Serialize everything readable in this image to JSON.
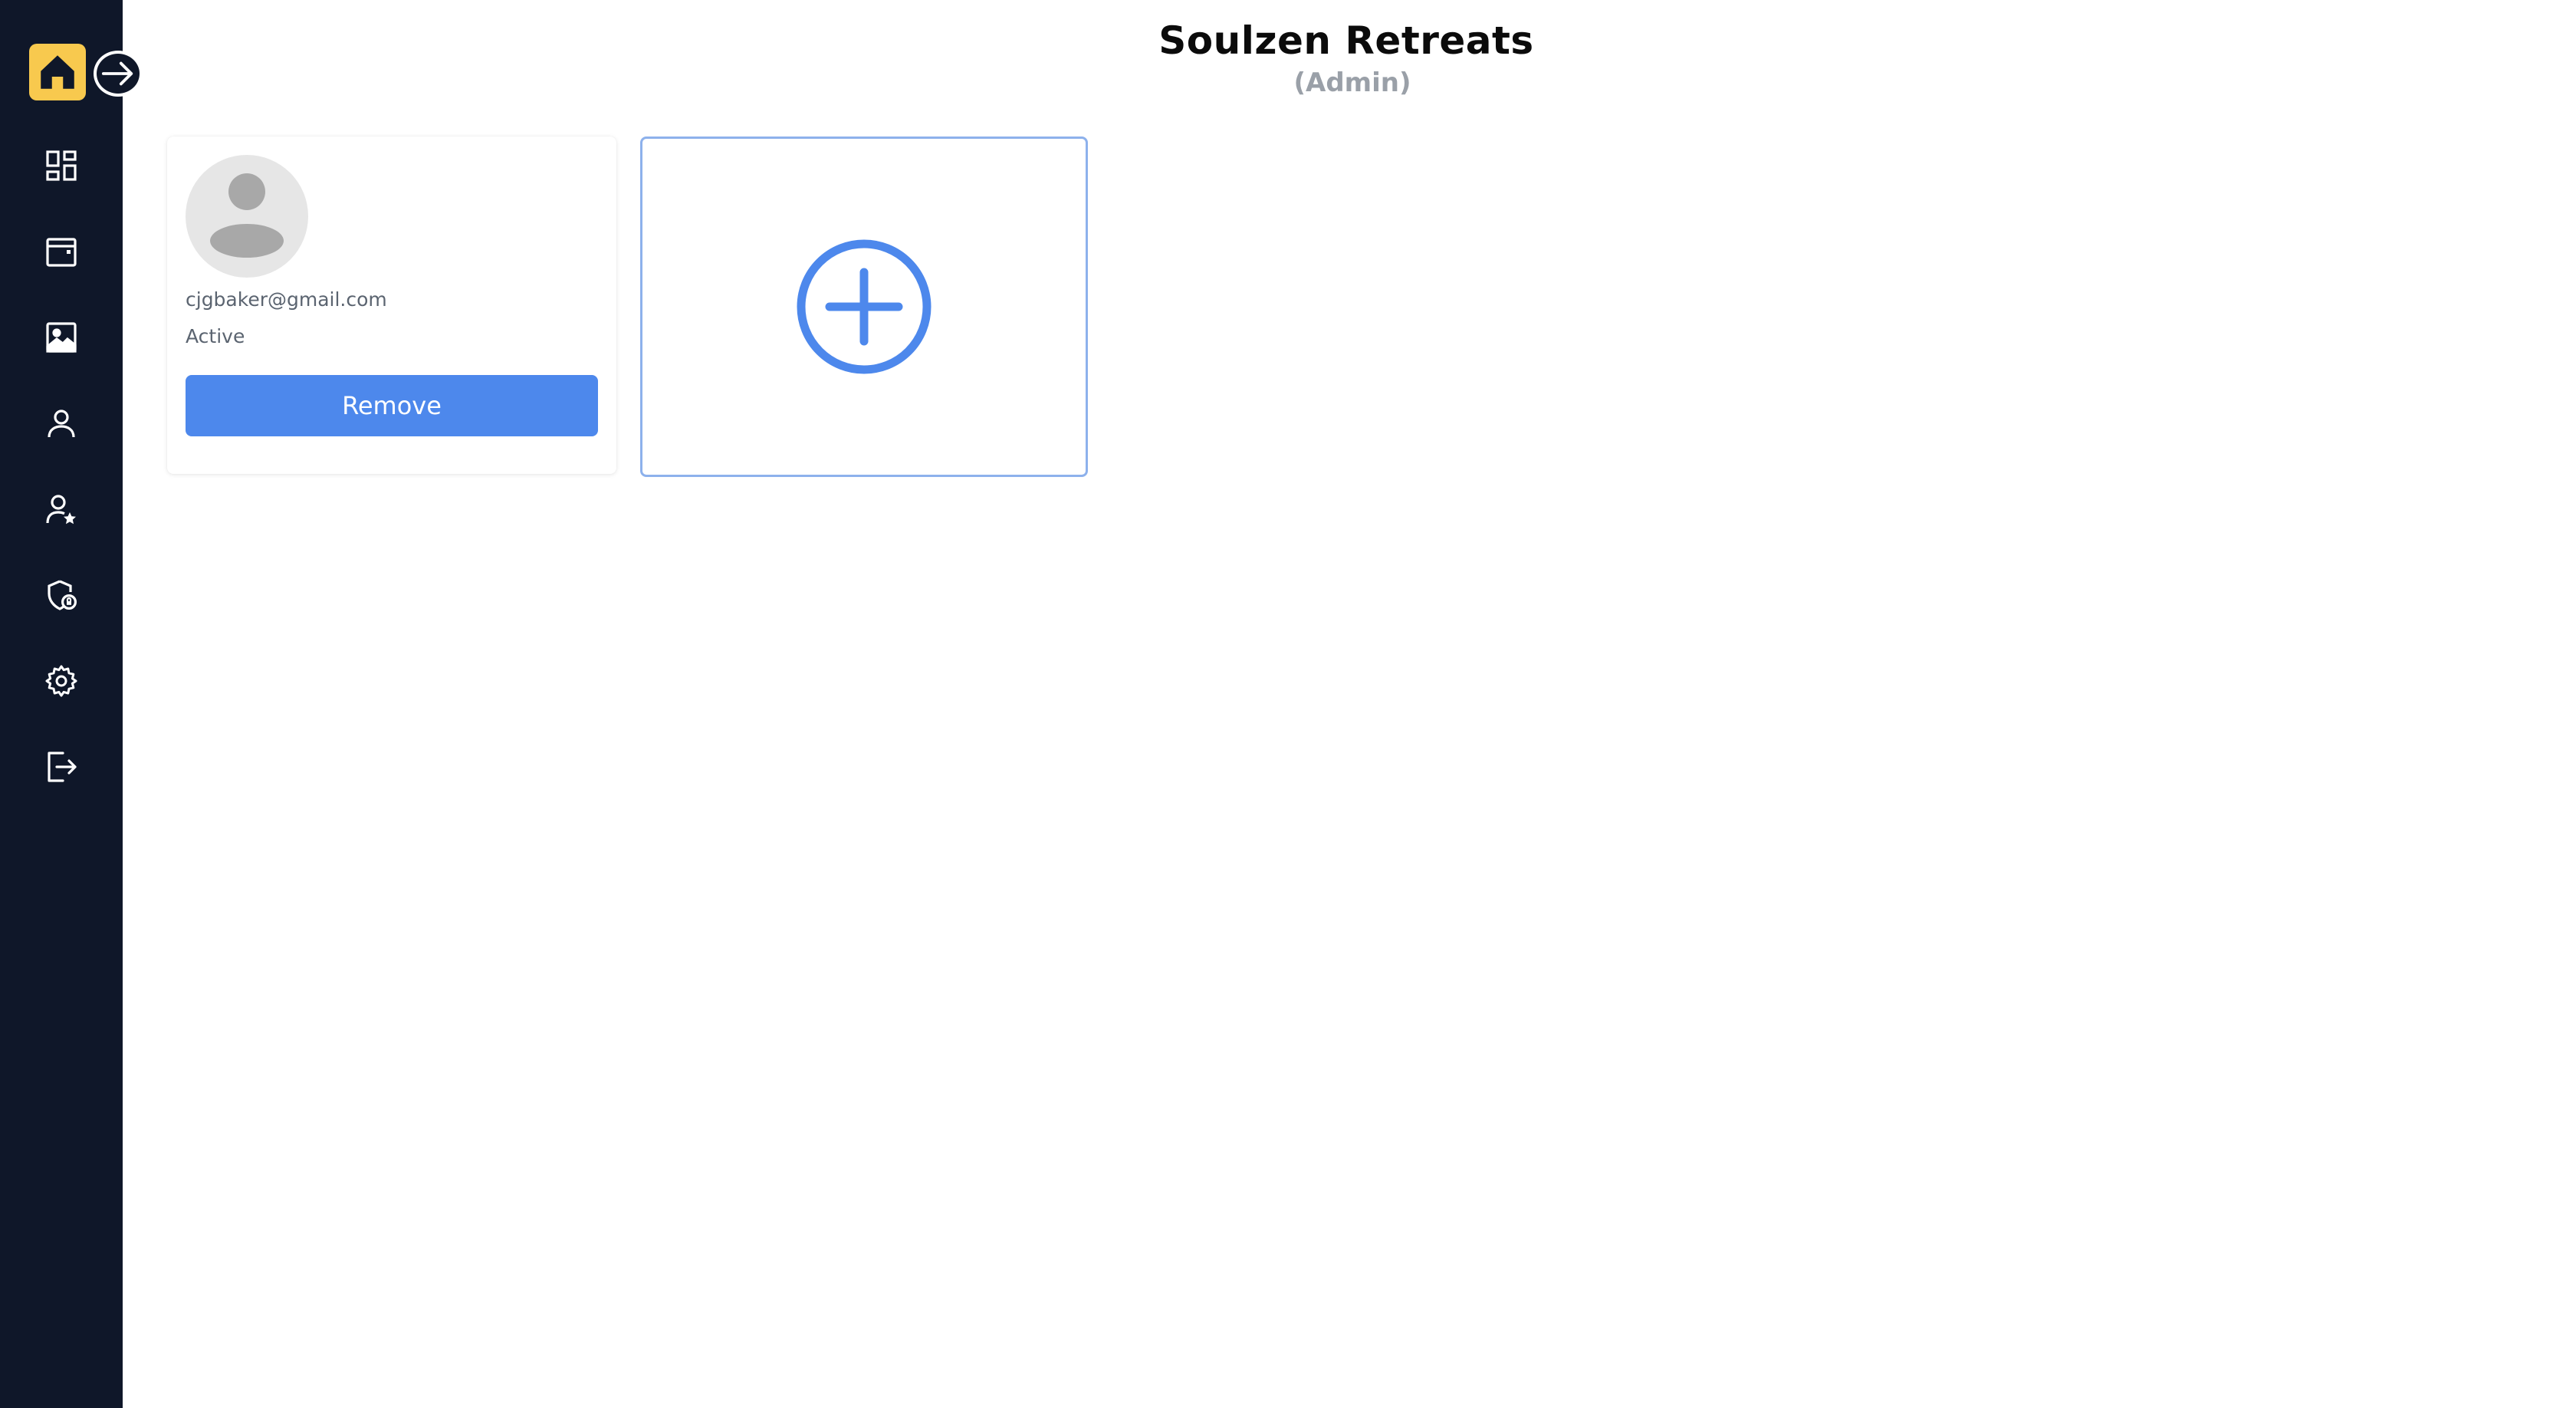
{
  "header": {
    "title": "Soulzen Retreats",
    "subtitle": "(Admin)"
  },
  "sidebar": {
    "home_icon": "home-icon",
    "expand_icon": "arrow-right-circle-icon",
    "items": [
      {
        "id": "dashboard",
        "icon": "dashboard-grid-icon"
      },
      {
        "id": "calendar",
        "icon": "calendar-icon"
      },
      {
        "id": "gallery",
        "icon": "image-icon"
      },
      {
        "id": "profile",
        "icon": "user-icon"
      },
      {
        "id": "user-star",
        "icon": "user-star-icon"
      },
      {
        "id": "security",
        "icon": "shield-lock-icon"
      },
      {
        "id": "settings",
        "icon": "gear-icon"
      },
      {
        "id": "logout",
        "icon": "logout-icon"
      }
    ]
  },
  "users": [
    {
      "email": "cjgbaker@gmail.com",
      "status": "Active",
      "remove_label": "Remove"
    }
  ],
  "add_card": {
    "icon": "plus-circle-icon"
  },
  "colors": {
    "sidebar_bg": "#0f1729",
    "home_accent": "#f8c94e",
    "primary": "#4d88ec",
    "add_card_border": "#8db1ec"
  }
}
